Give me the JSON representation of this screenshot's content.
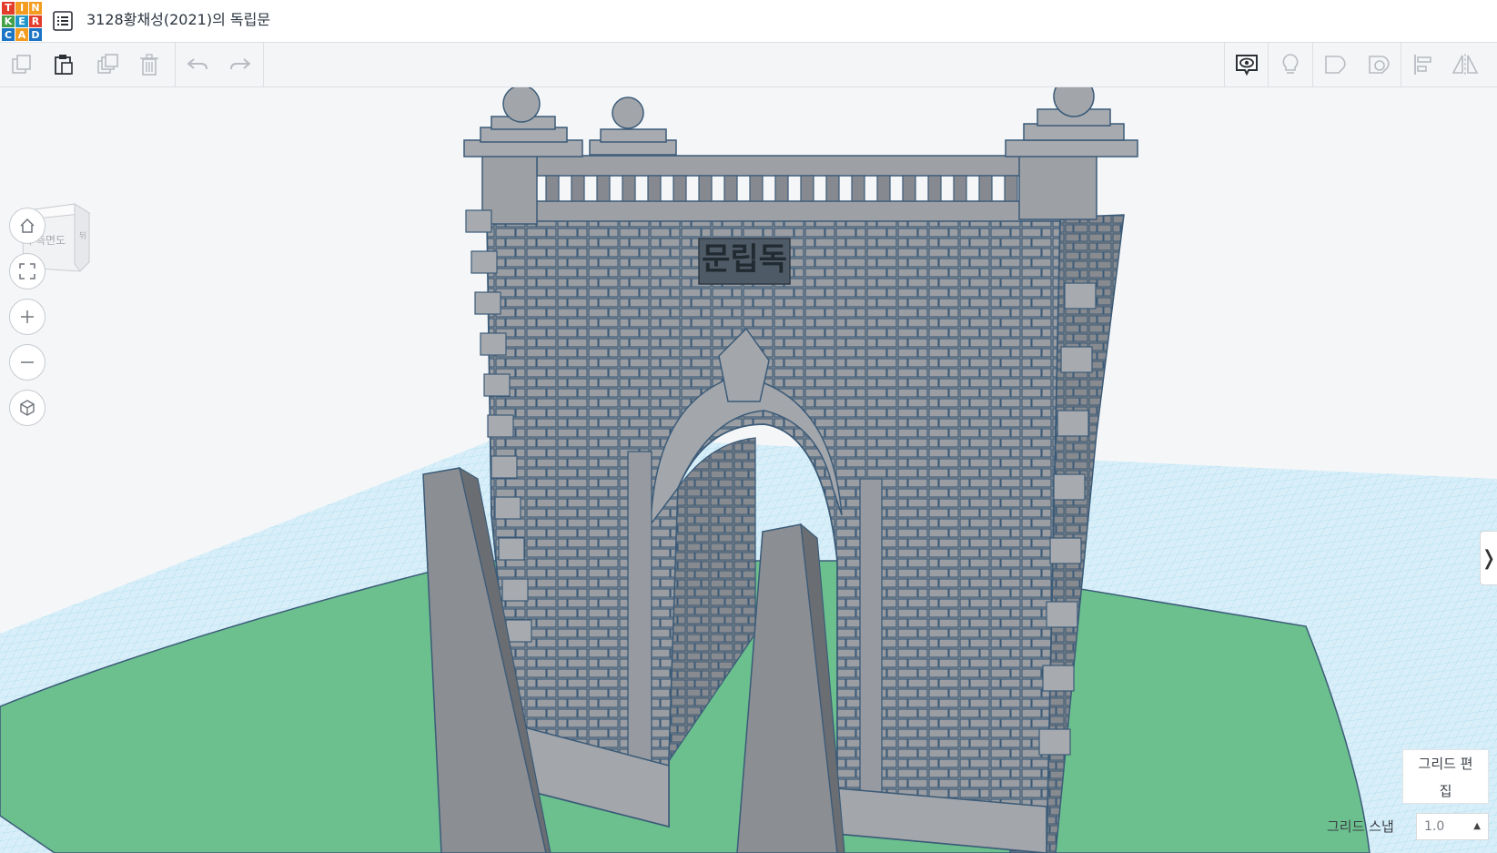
{
  "app": {
    "logo_letters": [
      "T",
      "I",
      "N",
      "K",
      "E",
      "R",
      "C",
      "A",
      "D"
    ],
    "logo_colors": [
      "#e23c2b",
      "#f39c1f",
      "#f39c1f",
      "#43a047",
      "#2196c8",
      "#e23c2b",
      "#1b74c5",
      "#f39c1f",
      "#1b74c5"
    ],
    "document_title": "3128황채성(2021)의 독립문"
  },
  "toolbar": {
    "left_icons": [
      "copy-icon",
      "paste-icon",
      "duplicate-icon",
      "delete-icon",
      "undo-icon",
      "redo-icon"
    ],
    "right_icons": [
      "notes-visibility-icon",
      "light-bulb-icon",
      "solid-shape-icon",
      "hole-shape-icon",
      "align-icon",
      "mirror-icon"
    ]
  },
  "viewcube": {
    "face_label": "우측면도",
    "side_label": "뒤"
  },
  "nav_controls": [
    "home-view-icon",
    "fit-all-icon",
    "zoom-in-icon",
    "zoom-out-icon",
    "ortho-view-icon"
  ],
  "model": {
    "plaque_text": "문립독"
  },
  "grid": {
    "edit_label_line1": "그리드 편",
    "edit_label_line2": "집",
    "snap_label": "그리드 스냅",
    "snap_value": "1.0"
  },
  "colors": {
    "grid_line": "#9fd4ec",
    "workplane": "#cfeaf6",
    "ground_green": "#6cc08e",
    "stone": "#8f9297",
    "stone_dark": "#6a6d72",
    "outline": "#3b5b78"
  }
}
